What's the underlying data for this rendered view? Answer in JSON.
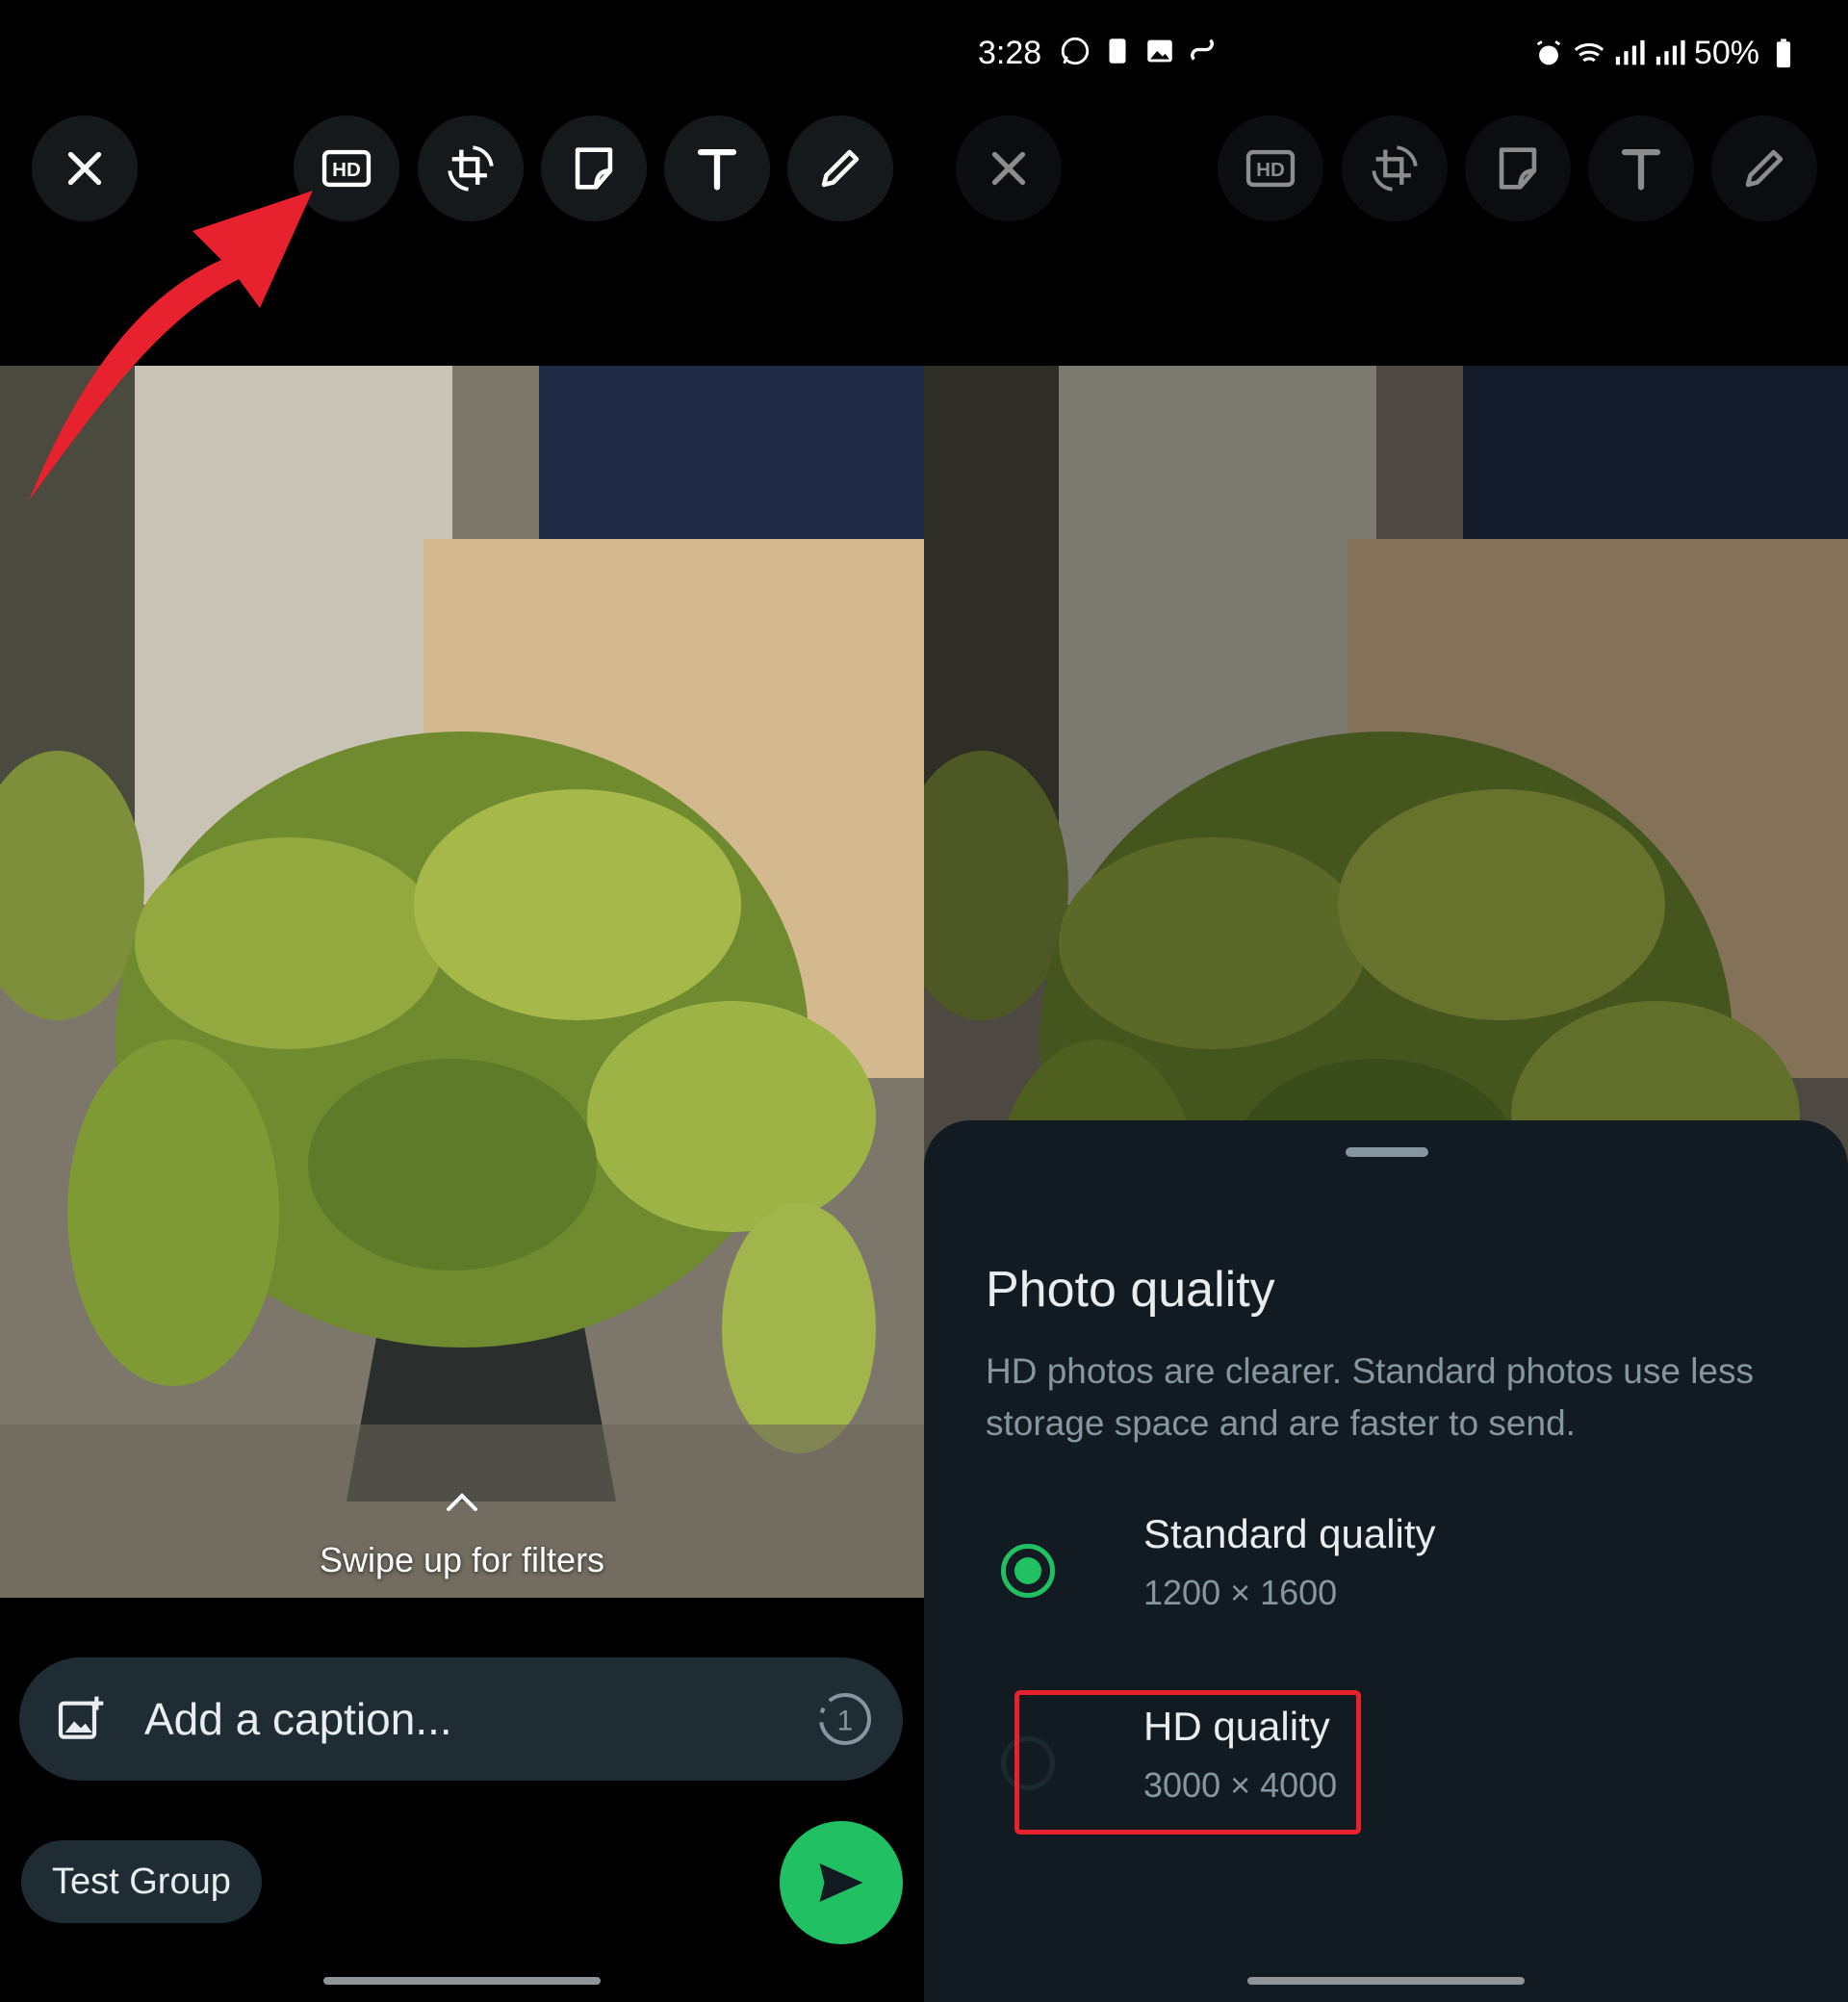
{
  "status_bar": {
    "time": "3:28",
    "battery": "50%",
    "icons_left": [
      "whatsapp-icon",
      "phone-icon",
      "image-icon",
      "link-icon"
    ],
    "icons_right": [
      "alarm-icon",
      "wifi-icon",
      "signal-volte-1-icon",
      "signal-volte-2-icon",
      "battery-icon"
    ]
  },
  "toolbar": {
    "hd_label": "HD",
    "items": [
      "close-icon",
      "hd-icon",
      "crop-rotate-icon",
      "sticker-icon",
      "text-icon",
      "pencil-icon"
    ]
  },
  "editor": {
    "swipe_hint": "Swipe up for filters",
    "caption_placeholder": "Add a caption...",
    "view_once_label": "1",
    "recipient": "Test Group"
  },
  "quality_sheet": {
    "title": "Photo quality",
    "description": "HD photos are clearer. Standard photos use less storage space and are faster to send.",
    "options": [
      {
        "label": "Standard quality",
        "dimensions": "1200 × 1600",
        "selected": true
      },
      {
        "label": "HD quality",
        "dimensions": "3000 × 4000",
        "selected": false
      }
    ]
  },
  "colors": {
    "accent_green": "#21c063",
    "sheet_bg": "#121b22",
    "annotation_red": "#e8212f"
  }
}
